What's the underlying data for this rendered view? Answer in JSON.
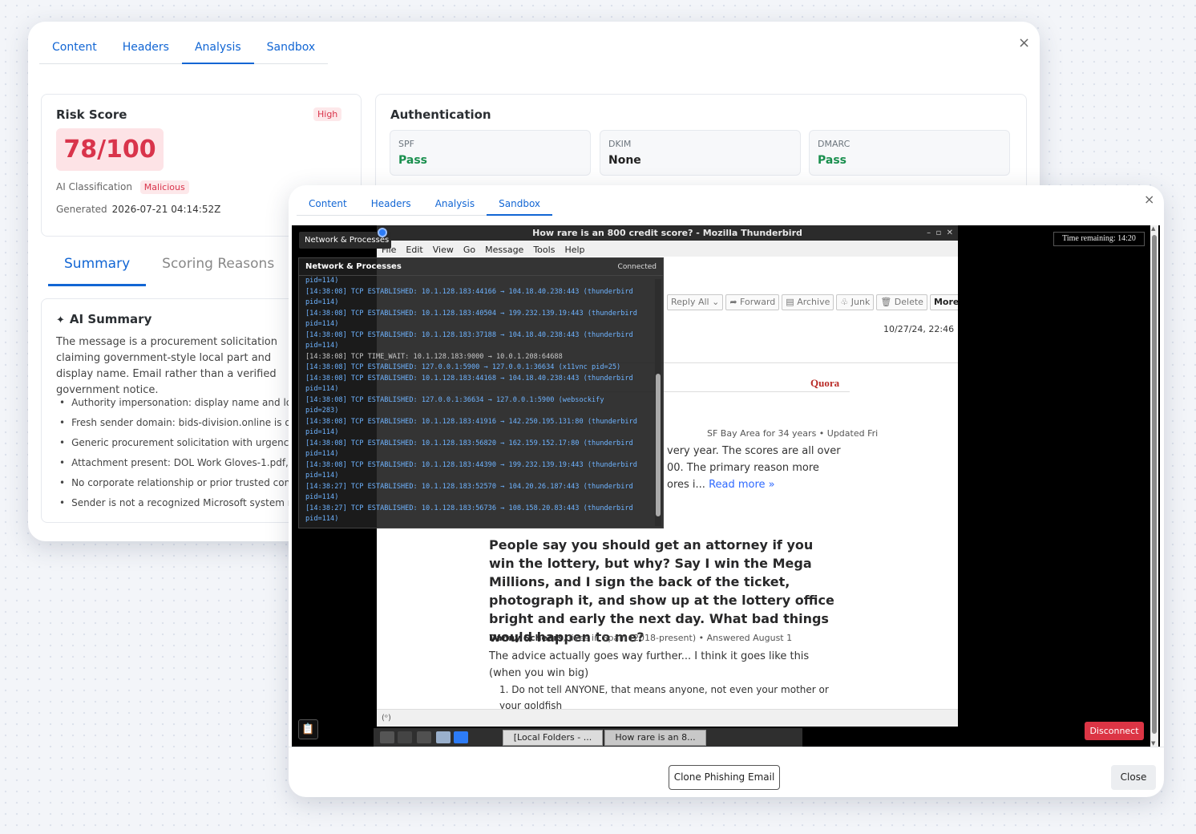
{
  "back_modal": {
    "tabs": [
      "Content",
      "Headers",
      "Analysis",
      "Sandbox"
    ],
    "close": "×",
    "risk": {
      "title": "Risk Score",
      "level": "High",
      "score": "78/100",
      "classification_label": "AI Classification",
      "classification": "Malicious",
      "generated_label": "Generated",
      "generated": "2026-07-21 04:14:52Z"
    },
    "auth": {
      "title": "Authentication",
      "items": [
        {
          "label": "SPF",
          "value": "Pass",
          "color": "#1a8f4e"
        },
        {
          "label": "DKIM",
          "value": "None",
          "color": "#222222"
        },
        {
          "label": "DMARC",
          "value": "Pass",
          "color": "#1a8f4e"
        }
      ]
    },
    "subtabs": [
      "Summary",
      "Scoring Reasons"
    ],
    "summary": {
      "title": "AI Summary",
      "text": "The message is a procurement solicitation claiming government-style local part and display name. Email rather than a verified government notice.",
      "bullets": [
        "Authority impersonation: display name and loc",
        "Fresh sender domain: bids-division.online is or",
        "Generic procurement solicitation with urgency",
        "Attachment present: DOL Work Gloves-1.pdf,",
        "No corporate relationship or prior trusted comm",
        "Sender is not a recognized Microsoft system no"
      ]
    }
  },
  "front_modal": {
    "tabs": [
      "Content",
      "Headers",
      "Analysis",
      "Sandbox"
    ],
    "close": "×",
    "time_remaining": "Time remaining: 14:20",
    "disconnect": "Disconnect",
    "thunderbird": {
      "title": "How rare is an 800 credit score? - Mozilla Thunderbird",
      "menu": [
        "File",
        "Edit",
        "View",
        "Go",
        "Message",
        "Tools",
        "Help"
      ],
      "toolbar": [
        "Reply All",
        "Forward",
        "Archive",
        "Junk",
        "Delete",
        "More"
      ],
      "date": "10/27/24, 22:46",
      "brand": "Quora",
      "author1": "SF Bay Area for 34 years • Updated Fri",
      "body1": [
        "very year. The scores are all over",
        "00. The primary reason more",
        "ores i..."
      ],
      "read_more": "Read more »",
      "q2_title": "People say you should get an attorney if you win the lottery, but why? Say I win the Mega Millions, and I sign the back of the ticket, photograph it, and show up at the lottery office bright and early the next day. What bad things would happen to me?",
      "q2_author_name": "Danny Scheers",
      "q2_author_meta": ", lives in Spain (2018-present) • Answered August 1",
      "q2_answer": "The advice actually goes way further... I think it goes like this (when you win big)",
      "q2_list": "1. Do not tell ANYONE, that means anyone, not even your mother or your goldfish",
      "status": "(ᵒ)"
    },
    "network": {
      "tab_label": "Network & Processes",
      "title": "Network & Processes",
      "status": "Connected",
      "log": [
        {
          "t": "pid=114)",
          "c": ""
        },
        {
          "t": "[14:38:08] TCP ESTABLISHED: 10.1.128.183:44166 → 104.18.40.238:443 (thunderbird",
          "c": ""
        },
        {
          "t": "pid=114)",
          "c": ""
        },
        {
          "t": "[14:38:08] TCP ESTABLISHED: 10.1.128.183:40504 → 199.232.139.19:443 (thunderbird",
          "c": ""
        },
        {
          "t": "pid=114)",
          "c": ""
        },
        {
          "t": "[14:38:08] TCP ESTABLISHED: 10.1.128.183:37188 → 104.18.40.238:443 (thunderbird",
          "c": ""
        },
        {
          "t": "pid=114)",
          "c": ""
        },
        {
          "t": "[14:38:08] TCP TIME_WAIT: 10.1.128.183:9000 → 10.0.1.208:64688",
          "c": "grey"
        },
        {
          "t": "[14:38:08] TCP ESTABLISHED: 127.0.0.1:5900 → 127.0.0.1:36634 (x11vnc pid=25)",
          "c": ""
        },
        {
          "t": "[14:38:08] TCP ESTABLISHED: 10.1.128.183:44168 → 104.18.40.238:443 (thunderbird",
          "c": ""
        },
        {
          "t": "pid=114)",
          "c": ""
        },
        {
          "t": "[14:38:08] TCP ESTABLISHED: 127.0.0.1:36634 → 127.0.0.1:5900 (websockify",
          "c": ""
        },
        {
          "t": "pid=283)",
          "c": ""
        },
        {
          "t": "[14:38:08] TCP ESTABLISHED: 10.1.128.183:41916 → 142.250.195.131:80 (thunderbird",
          "c": ""
        },
        {
          "t": "pid=114)",
          "c": ""
        },
        {
          "t": "[14:38:08] TCP ESTABLISHED: 10.1.128.183:56820 → 162.159.152.17:80 (thunderbird",
          "c": ""
        },
        {
          "t": "pid=114)",
          "c": ""
        },
        {
          "t": "[14:38:08] TCP ESTABLISHED: 10.1.128.183:44390 → 199.232.139.19:443 (thunderbird",
          "c": ""
        },
        {
          "t": "pid=114)",
          "c": ""
        },
        {
          "t": "[14:38:27] TCP ESTABLISHED: 10.1.128.183:52570 → 104.20.26.187:443 (thunderbird",
          "c": ""
        },
        {
          "t": "pid=114)",
          "c": ""
        },
        {
          "t": "[14:38:27] TCP ESTABLISHED: 10.1.128.183:56736 → 108.158.20.83:443 (thunderbird",
          "c": ""
        },
        {
          "t": "pid=114)",
          "c": ""
        }
      ]
    },
    "taskbar": [
      "[Local Folders - ...",
      "How rare is an 8..."
    ],
    "footer": {
      "clone": "Clone Phishing Email",
      "close": "Close"
    }
  }
}
